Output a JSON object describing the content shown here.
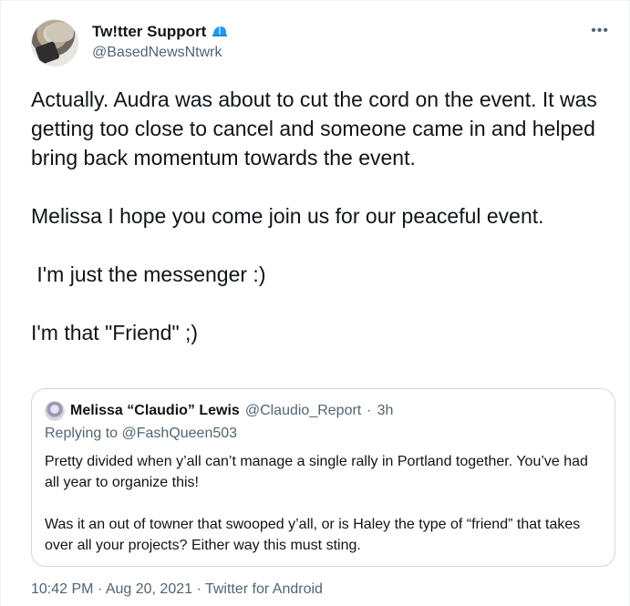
{
  "author": {
    "display_name": "Tw!tter Support",
    "handle": "@BasedNewsNtwrk",
    "badge_icon": "blue-cap-icon"
  },
  "more_label": "•••",
  "tweet": {
    "lines": [
      "Actually. Audra was about to cut the cord on the event. It was getting too close to cancel and someone came in and helped bring back momentum towards the event.",
      "Melissa I hope you come join us for our peaceful event.",
      " I'm just the messenger :)",
      "I'm that \"Friend\" ;)"
    ]
  },
  "quoted": {
    "display_name": "Melissa “Claudio” Lewis",
    "handle": "@Claudio_Report",
    "separator": "·",
    "time": "3h",
    "replying_label": "Replying to",
    "replying_handle": "@FashQueen503",
    "paragraphs": [
      "Pretty divided when y’all can’t manage a single rally in Portland together. You’ve had all year to organize this!",
      "Was it an out of towner that swooped y’all, or is Haley the type of “friend” that takes over all your projects? Either way this must sting."
    ]
  },
  "meta": {
    "time": "10:42 PM",
    "sep1": "·",
    "date": "Aug 20, 2021",
    "sep2": "·",
    "source": "Twitter for Android"
  },
  "colors": {
    "text": "#0f1419",
    "secondary": "#536471",
    "border": "#cfd9de",
    "badge_blue": "#1d9bf0"
  }
}
